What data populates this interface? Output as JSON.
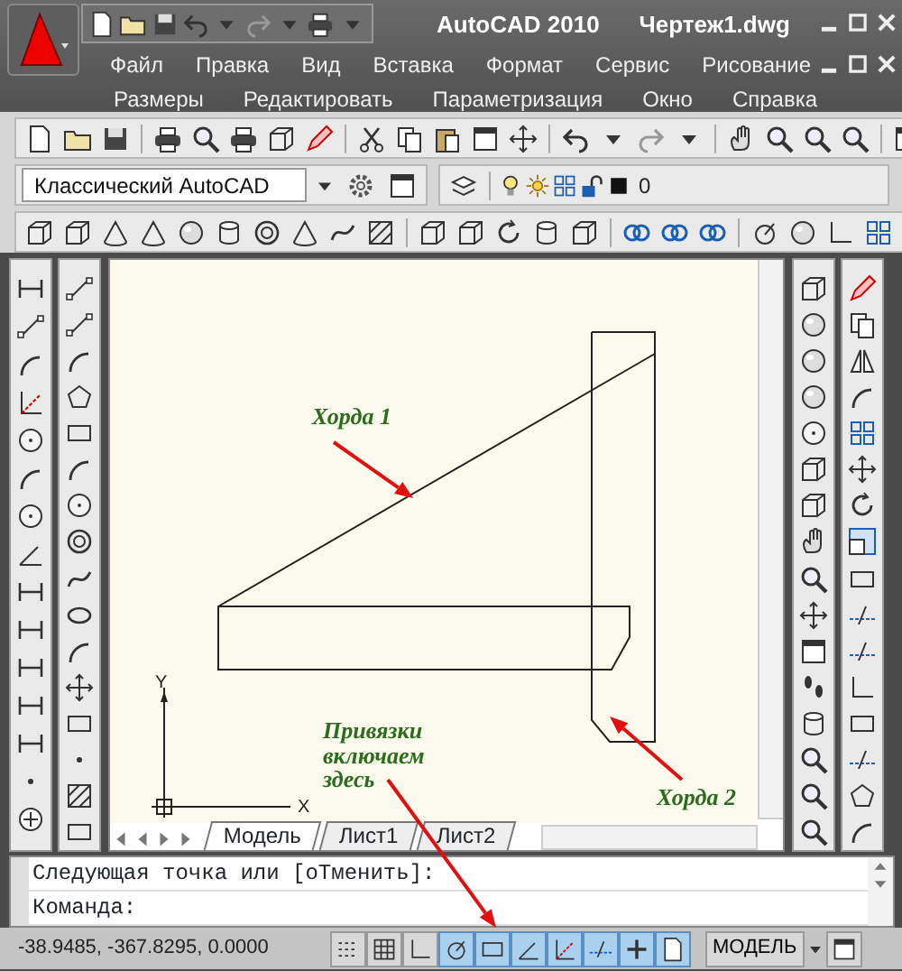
{
  "window": {
    "app_title": "AutoCAD 2010",
    "file_title": "Чертеж1.dwg"
  },
  "menu": [
    {
      "label": "Файл"
    },
    {
      "label": "Правка"
    },
    {
      "label": "Вид"
    },
    {
      "label": "Вставка"
    },
    {
      "label": "Формат"
    },
    {
      "label": "Сервис"
    },
    {
      "label": "Рисование"
    }
  ],
  "menu_row2": [
    {
      "label": "Размеры"
    },
    {
      "label": "Редактировать"
    },
    {
      "label": "Параметризация"
    },
    {
      "label": "Окно"
    },
    {
      "label": "Справка"
    }
  ],
  "workspace": {
    "value": "Классический AutoCAD"
  },
  "layer": {
    "name": "0"
  },
  "drawing": {
    "annotations": [
      {
        "text": "Хорда 1"
      },
      {
        "text": "Хорда 2"
      },
      {
        "text": "Привязки включаем здесь"
      }
    ],
    "ucs": {
      "x": "X",
      "y": "Y"
    }
  },
  "layout_tabs": [
    {
      "label": "Модель",
      "selected": true
    },
    {
      "label": "Лист1",
      "selected": false
    },
    {
      "label": "Лист2",
      "selected": false
    }
  ],
  "command_lines": [
    "Следующая точка или [оТменить]:",
    "Команда:"
  ],
  "status_bar": {
    "coordinates": "-38.9485, -367.8295, 0.0000",
    "space": "МОДЕЛЬ",
    "toggles": [
      {
        "on": false
      },
      {
        "on": false
      },
      {
        "on": false
      },
      {
        "on": true
      },
      {
        "on": true
      },
      {
        "on": true
      },
      {
        "on": true
      },
      {
        "on": true
      },
      {
        "on": true
      },
      {
        "on": true
      }
    ]
  }
}
